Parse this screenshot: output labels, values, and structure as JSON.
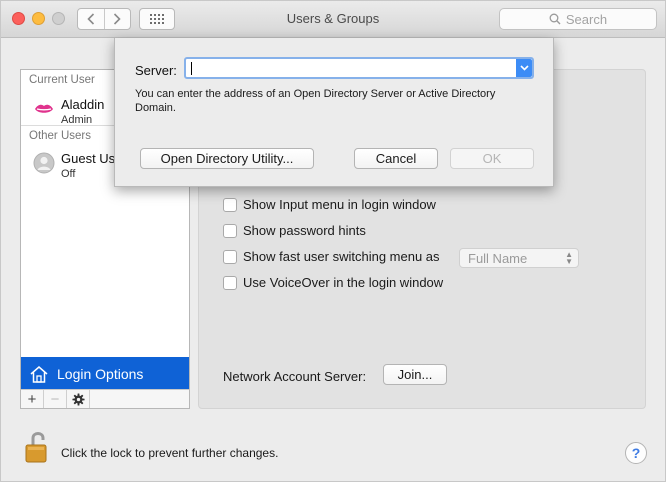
{
  "window": {
    "title": "Users & Groups",
    "search_placeholder": "Search"
  },
  "sidebar": {
    "current_user_header": "Current User",
    "other_users_header": "Other Users",
    "current_user": {
      "name": "Aladdin",
      "role": "Admin"
    },
    "other_users": [
      {
        "name": "Guest Us",
        "role": "Off"
      }
    ],
    "login_options_label": "Login Options",
    "add_label": "+",
    "remove_label": "−"
  },
  "login_options": {
    "checkboxes": [
      {
        "label": "Show Input menu in login window",
        "checked": false
      },
      {
        "label": "Show password hints",
        "checked": false
      },
      {
        "label": "Show fast user switching menu as",
        "checked": false
      },
      {
        "label": "Use VoiceOver in the login window",
        "checked": false
      }
    ],
    "fast_switch_popup_value": "Full Name",
    "network_account_server_label": "Network Account Server:",
    "join_label": "Join..."
  },
  "sheet": {
    "server_label": "Server:",
    "server_value": "",
    "hint": "You can enter the address of an Open Directory Server or Active Directory Domain.",
    "odu_label": "Open Directory Utility...",
    "cancel_label": "Cancel",
    "ok_label": "OK"
  },
  "footer": {
    "lock_text": "Click the lock to prevent further changes.",
    "help_label": "?"
  },
  "colors": {
    "accent": "#0f62d6",
    "focus_ring": "#86b1ea",
    "close": "#fc605c",
    "minimize": "#fdbc40",
    "lock": "#d89a2e"
  }
}
